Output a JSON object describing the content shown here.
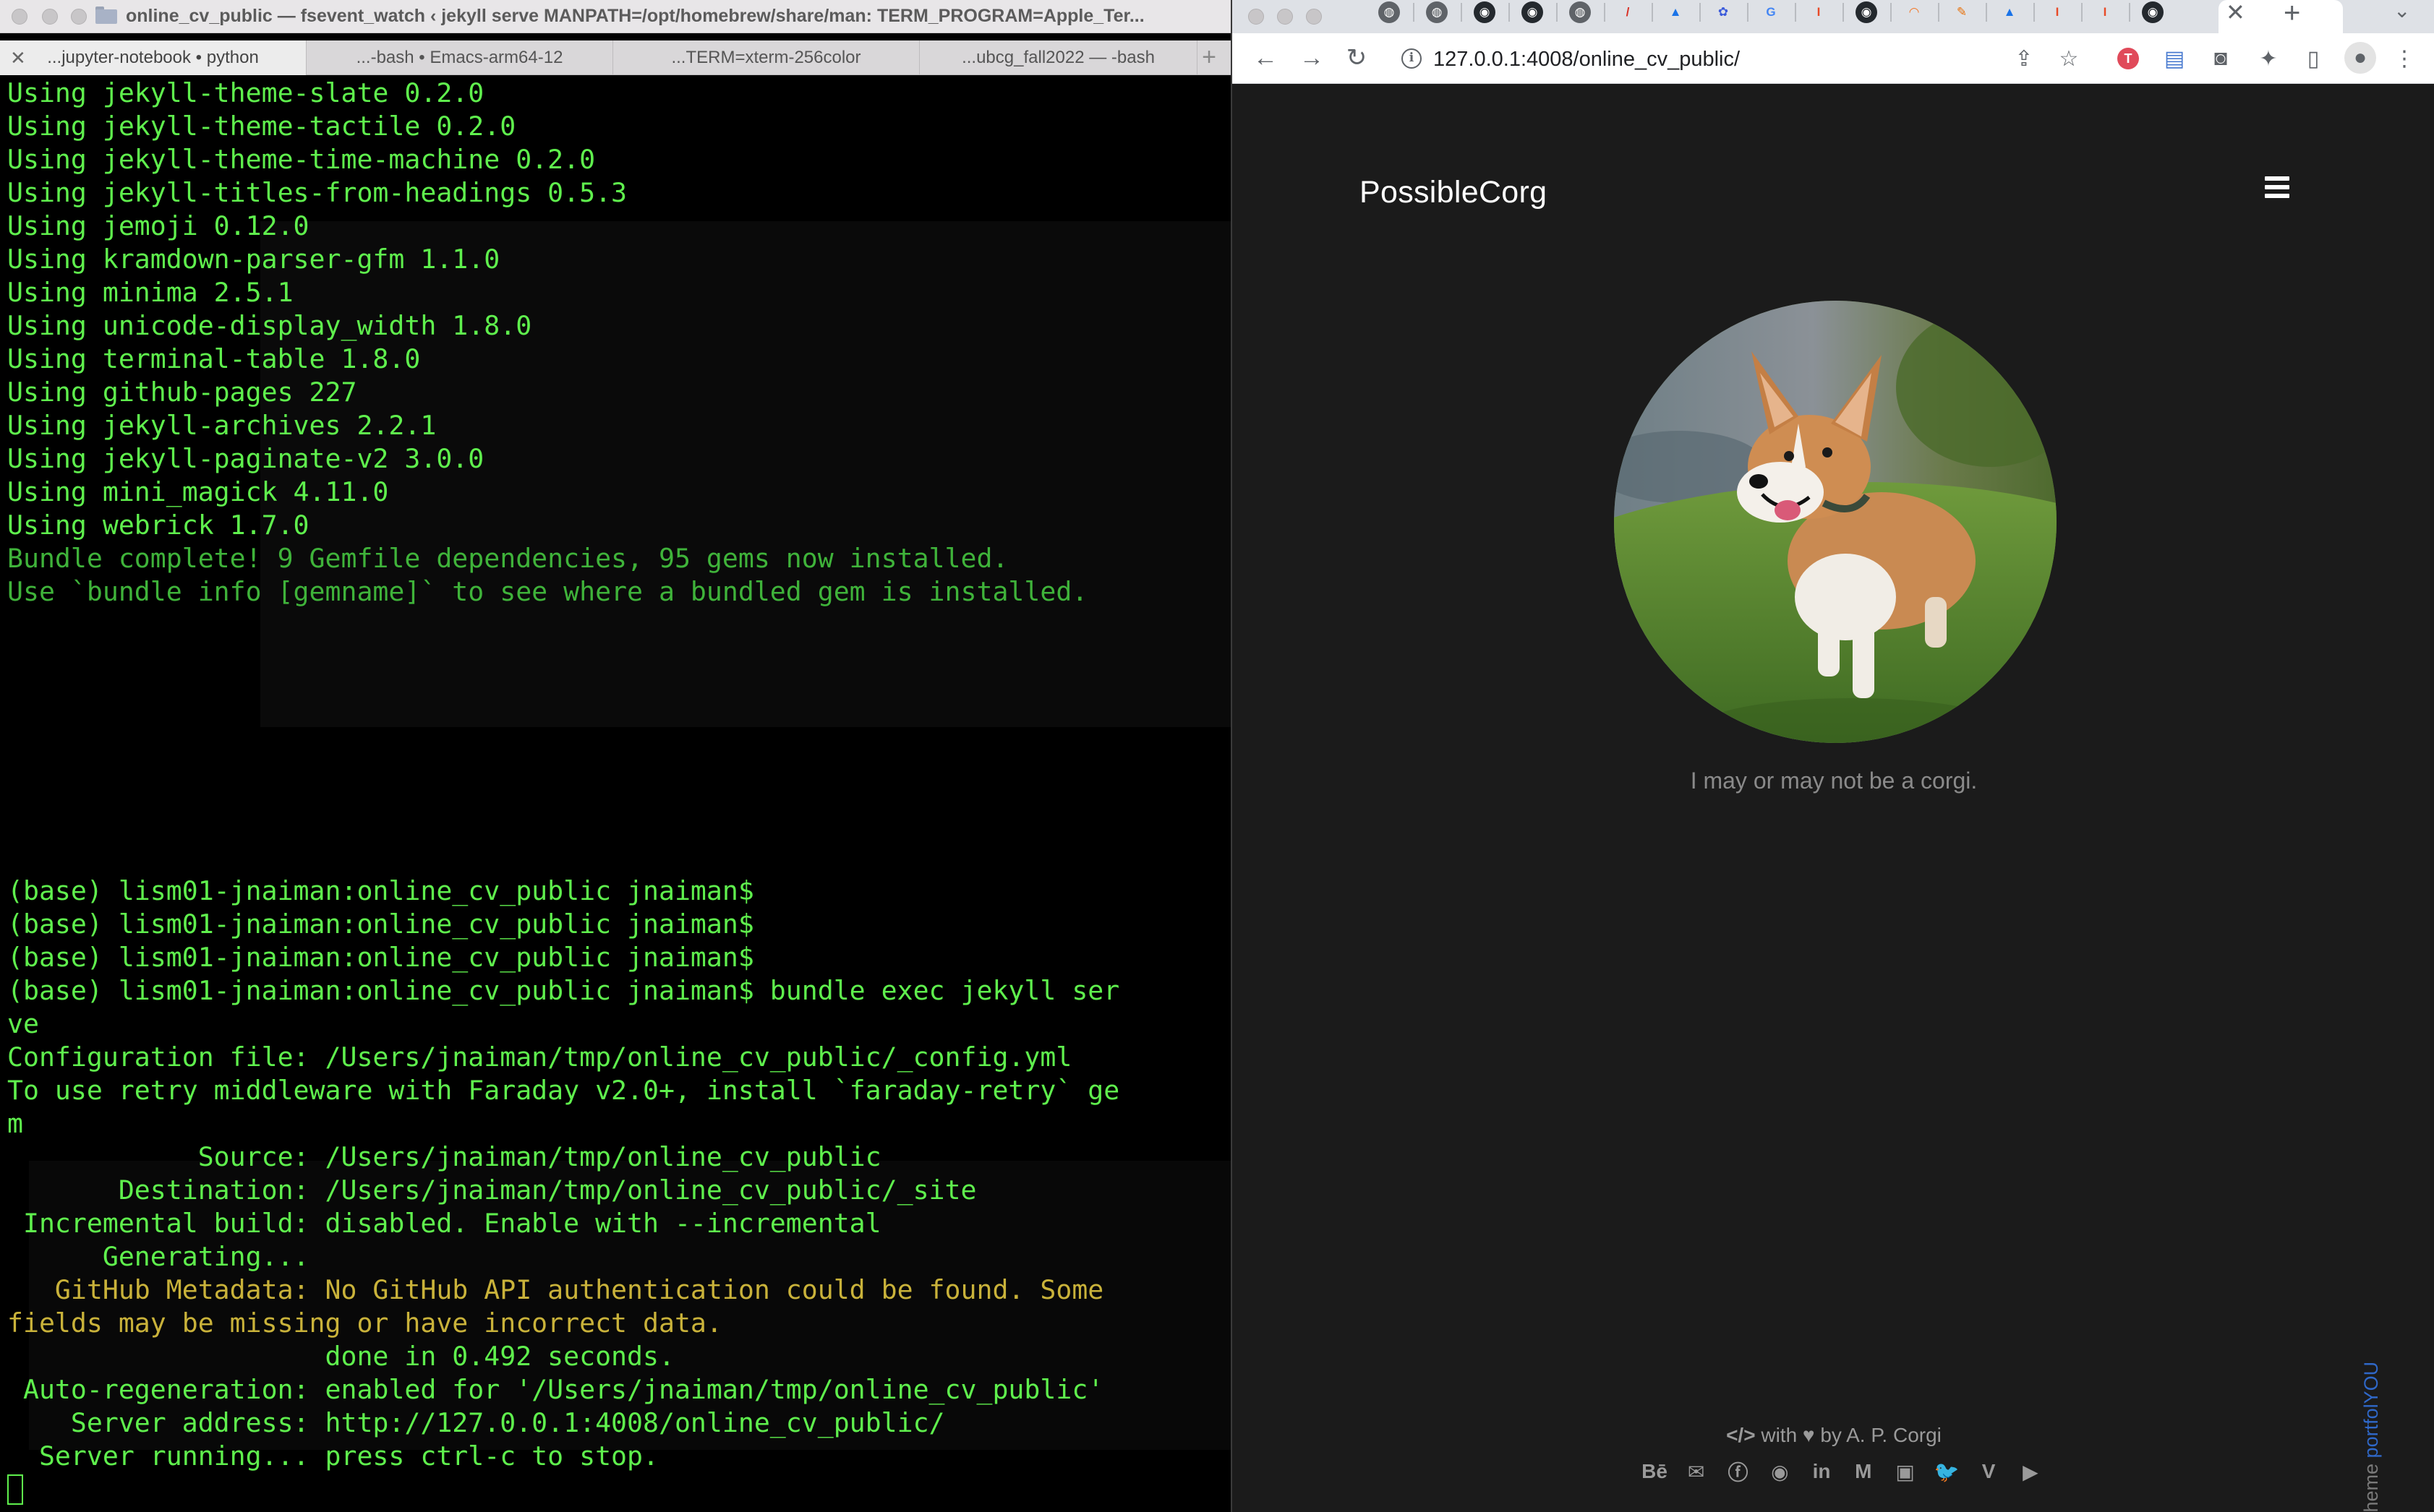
{
  "terminal": {
    "title": "online_cv_public — fsevent_watch ‹ jekyll serve MANPATH=/opt/homebrew/share/man: TERM_PROGRAM=Apple_Ter...",
    "tabs": [
      {
        "label": "...jupyter-notebook • python",
        "close": "✕"
      },
      {
        "label": "...-bash • Emacs-arm64-12"
      },
      {
        "label": "...TERM=xterm-256color"
      },
      {
        "label": "...ubcg_fall2022 — -bash"
      }
    ],
    "new_tab": "+",
    "lines": [
      {
        "text": "Using jekyll-theme-slate 0.2.0",
        "style": "green"
      },
      {
        "text": "Using jekyll-theme-tactile 0.2.0",
        "style": "green"
      },
      {
        "text": "Using jekyll-theme-time-machine 0.2.0",
        "style": "green"
      },
      {
        "text": "Using jekyll-titles-from-headings 0.5.3",
        "style": "green"
      },
      {
        "text": "Using jemoji 0.12.0",
        "style": "green"
      },
      {
        "text": "Using kramdown-parser-gfm 1.1.0",
        "style": "green"
      },
      {
        "text": "Using minima 2.5.1",
        "style": "green"
      },
      {
        "text": "Using unicode-display_width 1.8.0",
        "style": "green"
      },
      {
        "text": "Using terminal-table 1.8.0",
        "style": "green"
      },
      {
        "text": "Using github-pages 227",
        "style": "green"
      },
      {
        "text": "Using jekyll-archives 2.2.1",
        "style": "green"
      },
      {
        "text": "Using jekyll-paginate-v2 3.0.0",
        "style": "green"
      },
      {
        "text": "Using mini_magick 4.11.0",
        "style": "green"
      },
      {
        "text": "Using webrick 1.7.0",
        "style": "green"
      },
      {
        "text": "Bundle complete! 9 Gemfile dependencies, 95 gems now installed.",
        "style": "dim"
      },
      {
        "text": "Use `bundle info [gemname]` to see where a bundled gem is installed.",
        "style": "dim"
      },
      {
        "text": "",
        "style": "green"
      },
      {
        "text": "",
        "style": "green"
      },
      {
        "text": "",
        "style": "green"
      },
      {
        "text": "",
        "style": "green"
      },
      {
        "text": "",
        "style": "green"
      },
      {
        "text": "",
        "style": "green"
      },
      {
        "text": "",
        "style": "green"
      },
      {
        "text": "",
        "style": "green"
      },
      {
        "text": "(base) lism01-jnaiman:online_cv_public jnaiman$",
        "style": "green"
      },
      {
        "text": "(base) lism01-jnaiman:online_cv_public jnaiman$",
        "style": "green"
      },
      {
        "text": "(base) lism01-jnaiman:online_cv_public jnaiman$",
        "style": "green"
      },
      {
        "text": "(base) lism01-jnaiman:online_cv_public jnaiman$ bundle exec jekyll ser",
        "style": "green"
      },
      {
        "text": "ve",
        "style": "green"
      },
      {
        "text": "Configuration file: /Users/jnaiman/tmp/online_cv_public/_config.yml",
        "style": "green"
      },
      {
        "text": "To use retry middleware with Faraday v2.0+, install `faraday-retry` ge",
        "style": "green"
      },
      {
        "text": "m",
        "style": "green"
      },
      {
        "text": "            Source: /Users/jnaiman/tmp/online_cv_public",
        "style": "green"
      },
      {
        "text": "       Destination: /Users/jnaiman/tmp/online_cv_public/_site",
        "style": "green"
      },
      {
        "text": " Incremental build: disabled. Enable with --incremental",
        "style": "green"
      },
      {
        "text": "      Generating...",
        "style": "green"
      },
      {
        "text": "   GitHub Metadata: No GitHub API authentication could be found. Some",
        "style": "yellow"
      },
      {
        "text": "fields may be missing or have incorrect data.",
        "style": "yellow"
      },
      {
        "text": "                    done in 0.492 seconds.",
        "style": "green"
      },
      {
        "text": " Auto-regeneration: enabled for '/Users/jnaiman/tmp/online_cv_public'",
        "style": "green"
      },
      {
        "text": "    Server address: http://127.0.0.1:4008/online_cv_public/",
        "style": "green"
      },
      {
        "text": "  Server running... press ctrl-c to stop.",
        "style": "green"
      }
    ]
  },
  "browser": {
    "favicons": [
      {
        "name": "globe-favicon",
        "glyph": "◍",
        "bg": "#5f6368"
      },
      {
        "name": "globe-favicon-2",
        "glyph": "◍",
        "bg": "#5f6368"
      },
      {
        "name": "github-favicon",
        "glyph": "◉",
        "bg": "#24292e"
      },
      {
        "name": "github-favicon-2",
        "glyph": "◉",
        "bg": "#24292e"
      },
      {
        "name": "globe-favicon-3",
        "glyph": "◍",
        "bg": "#5f6368"
      },
      {
        "name": "slash-favicon",
        "glyph": "/",
        "bg": "#dee1e6",
        "fg": "#d93025"
      },
      {
        "name": "drive-favicon",
        "glyph": "▲",
        "bg": "#dee1e6",
        "fg": "#1a73e8"
      },
      {
        "name": "flower-favicon",
        "glyph": "✿",
        "bg": "#dee1e6",
        "fg": "#3b5bdb"
      },
      {
        "name": "google-favicon",
        "glyph": "G",
        "bg": "#dee1e6",
        "fg": "#4285f4"
      },
      {
        "name": "illinois-favicon",
        "glyph": "I",
        "bg": "#dee1e6",
        "fg": "#e84a27"
      },
      {
        "name": "github-favicon-3",
        "glyph": "◉",
        "bg": "#24292e"
      },
      {
        "name": "jupyter-favicon",
        "glyph": "◠",
        "bg": "#dee1e6",
        "fg": "#f37726"
      },
      {
        "name": "overleaf-favicon",
        "glyph": "✎",
        "bg": "#dee1e6",
        "fg": "#e8710a"
      },
      {
        "name": "drive-favicon-2",
        "glyph": "▲",
        "bg": "#dee1e6",
        "fg": "#1a73e8"
      },
      {
        "name": "illinois-favicon-2",
        "glyph": "I",
        "bg": "#dee1e6",
        "fg": "#e84a27"
      },
      {
        "name": "illinois-favicon-3",
        "glyph": "I",
        "bg": "#dee1e6",
        "fg": "#e84a27"
      },
      {
        "name": "github-favicon-4",
        "glyph": "◉",
        "bg": "#24292e"
      }
    ],
    "tab_close": "✕",
    "new_tab": "+",
    "tab_list": "⌄",
    "back": "←",
    "forward": "→",
    "reload": "↻",
    "url": "127.0.0.1:4008/online_cv_public/",
    "info": "i",
    "share": "⇪",
    "bookmark": "☆",
    "ext_red": "T",
    "ext_doc": "▤",
    "ext_incognito": "◙",
    "extensions": "✦",
    "sidepanel": "▯",
    "profile": "●",
    "menu": "⋮"
  },
  "page": {
    "logo": "PossibleCorg",
    "tagline": "I may or may not be a corgi.",
    "theme_credit": {
      "prefix": "theme ",
      "brand": "portfolYOU"
    },
    "footer": {
      "code_icon": "</>",
      "with": " with ",
      "heart": "♥",
      "by": " by A. P. Corgi"
    },
    "social": [
      {
        "name": "behance-icon",
        "glyph": "Bē"
      },
      {
        "name": "email-icon",
        "glyph": "✉"
      },
      {
        "name": "facebook-icon",
        "glyph": "ⓕ"
      },
      {
        "name": "github-icon",
        "glyph": "◉"
      },
      {
        "name": "linkedin-icon",
        "glyph": "in"
      },
      {
        "name": "medium-icon",
        "glyph": "M"
      },
      {
        "name": "twitch-icon",
        "glyph": "▣"
      },
      {
        "name": "twitter-icon",
        "glyph": "🐦"
      },
      {
        "name": "vimeo-icon",
        "glyph": "V"
      },
      {
        "name": "youtube-icon",
        "glyph": "▶"
      }
    ]
  }
}
